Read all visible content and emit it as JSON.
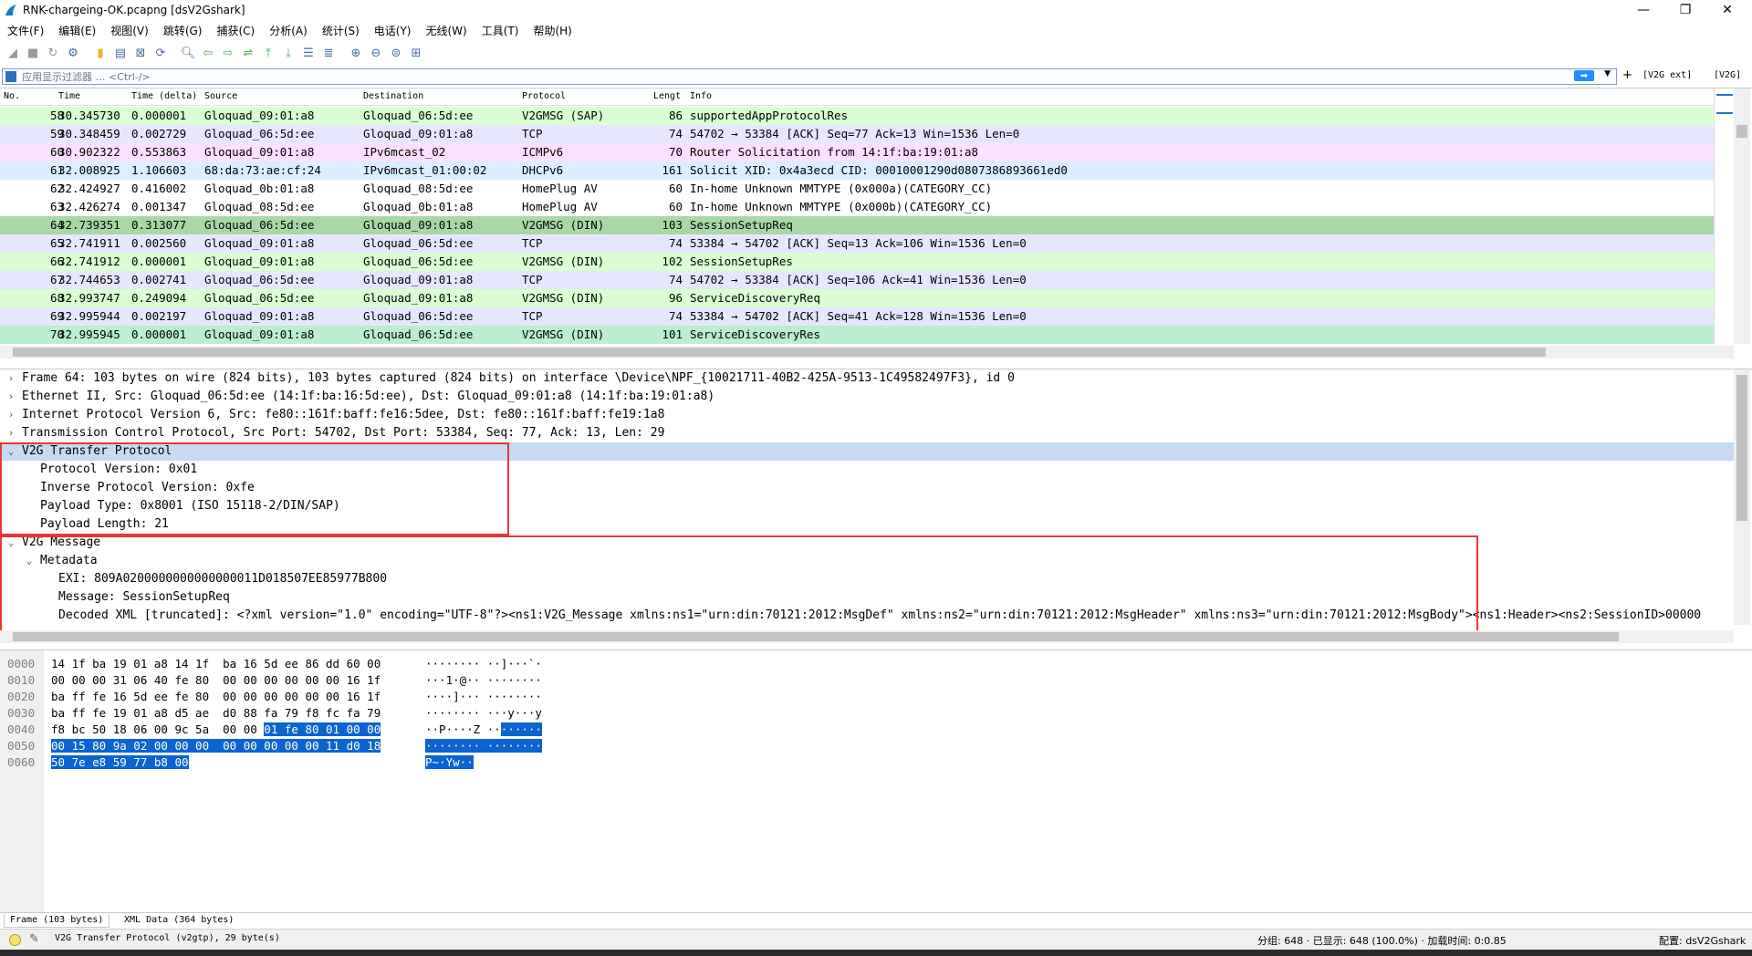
{
  "window": {
    "title": "RNK-chargeing-OK.pcapng [dsV2Gshark]",
    "minimize": "—",
    "maximize": "❐",
    "close": "✕"
  },
  "menu": [
    "文件(F)",
    "编辑(E)",
    "视图(V)",
    "跳转(G)",
    "捕获(C)",
    "分析(A)",
    "统计(S)",
    "电话(Y)",
    "无线(W)",
    "工具(T)",
    "帮助(H)"
  ],
  "filter": {
    "placeholder": "应用显示过滤器 … <Ctrl-/>",
    "apply": "➡",
    "plus": "+",
    "v2g_ext": "[V2G ext]",
    "v2g": "[V2G]"
  },
  "columns": [
    "No.",
    "Time",
    "Time (delta)",
    "Source",
    "Destination",
    "Protocol",
    "Lengt",
    "Info"
  ],
  "packets": [
    {
      "no": "58",
      "time": "30.345730",
      "delta": "0.000001",
      "src": "Gloquad_09:01:a8",
      "dst": "Gloquad_06:5d:ee",
      "proto": "V2GMSG (SAP)",
      "len": "86",
      "info": "supportedAppProtocolRes",
      "color": "#d9ffd2"
    },
    {
      "no": "59",
      "time": "30.348459",
      "delta": "0.002729",
      "src": "Gloquad_06:5d:ee",
      "dst": "Gloquad_09:01:a8",
      "proto": "TCP",
      "len": "74",
      "info": "54702 → 53384 [ACK] Seq=77 Ack=13 Win=1536 Len=0",
      "color": "#e7e6ff"
    },
    {
      "no": "60",
      "time": "30.902322",
      "delta": "0.553863",
      "src": "Gloquad_09:01:a8",
      "dst": "IPv6mcast_02",
      "proto": "ICMPv6",
      "len": "70",
      "info": "Router Solicitation from 14:1f:ba:19:01:a8",
      "color": "#fce0ff"
    },
    {
      "no": "61",
      "time": "32.008925",
      "delta": "1.106603",
      "src": "68:da:73:ae:cf:24",
      "dst": "IPv6mcast_01:00:02",
      "proto": "DHCPv6",
      "len": "161",
      "info": "Solicit XID: 0x4a3ecd CID: 00010001290d0807386893661ed0",
      "color": "#daeeff"
    },
    {
      "no": "62",
      "time": "32.424927",
      "delta": "0.416002",
      "src": "Gloquad_0b:01:a8",
      "dst": "Gloquad_08:5d:ee",
      "proto": "HomePlug AV",
      "len": "60",
      "info": "In-home Unknown MMTYPE (0x000a)(CATEGORY_CC)",
      "color": "#ffffff"
    },
    {
      "no": "63",
      "time": "32.426274",
      "delta": "0.001347",
      "src": "Gloquad_08:5d:ee",
      "dst": "Gloquad_0b:01:a8",
      "proto": "HomePlug AV",
      "len": "60",
      "info": "In-home Unknown MMTYPE (0x000b)(CATEGORY_CC)",
      "color": "#ffffff"
    },
    {
      "no": "64",
      "time": "32.739351",
      "delta": "0.313077",
      "src": "Gloquad_06:5d:ee",
      "dst": "Gloquad_09:01:a8",
      "proto": "V2GMSG (DIN)",
      "len": "103",
      "info": "SessionSetupReq",
      "color": "#a8d8a4"
    },
    {
      "no": "65",
      "time": "32.741911",
      "delta": "0.002560",
      "src": "Gloquad_09:01:a8",
      "dst": "Gloquad_06:5d:ee",
      "proto": "TCP",
      "len": "74",
      "info": "53384 → 54702 [ACK] Seq=13 Ack=106 Win=1536 Len=0",
      "color": "#e7e6ff"
    },
    {
      "no": "66",
      "time": "32.741912",
      "delta": "0.000001",
      "src": "Gloquad_09:01:a8",
      "dst": "Gloquad_06:5d:ee",
      "proto": "V2GMSG (DIN)",
      "len": "102",
      "info": "SessionSetupRes",
      "color": "#d9ffd2"
    },
    {
      "no": "67",
      "time": "32.744653",
      "delta": "0.002741",
      "src": "Gloquad_06:5d:ee",
      "dst": "Gloquad_09:01:a8",
      "proto": "TCP",
      "len": "74",
      "info": "54702 → 53384 [ACK] Seq=106 Ack=41 Win=1536 Len=0",
      "color": "#e7e6ff"
    },
    {
      "no": "68",
      "time": "32.993747",
      "delta": "0.249094",
      "src": "Gloquad_06:5d:ee",
      "dst": "Gloquad_09:01:a8",
      "proto": "V2GMSG (DIN)",
      "len": "96",
      "info": "ServiceDiscoveryReq",
      "color": "#d9ffd2"
    },
    {
      "no": "69",
      "time": "32.995944",
      "delta": "0.002197",
      "src": "Gloquad_09:01:a8",
      "dst": "Gloquad_06:5d:ee",
      "proto": "TCP",
      "len": "74",
      "info": "53384 → 54702 [ACK] Seq=41 Ack=128 Win=1536 Len=0",
      "color": "#e7e6ff"
    },
    {
      "no": "70",
      "time": "32.995945",
      "delta": "0.000001",
      "src": "Gloquad_09:01:a8",
      "dst": "Gloquad_06:5d:ee",
      "proto": "V2GMSG (DIN)",
      "len": "101",
      "info": "ServiceDiscoveryRes",
      "color": "#b9eed0"
    }
  ],
  "details": [
    {
      "arrow": "›",
      "indent": 0,
      "text": "Frame 64: 103 bytes on wire (824 bits), 103 bytes captured (824 bits) on interface \\Device\\NPF_{10021711-40B2-425A-9513-1C49582497F3}, id 0",
      "sel": false
    },
    {
      "arrow": "›",
      "indent": 0,
      "text": "Ethernet II, Src: Gloquad_06:5d:ee (14:1f:ba:16:5d:ee), Dst: Gloquad_09:01:a8 (14:1f:ba:19:01:a8)",
      "sel": false
    },
    {
      "arrow": "›",
      "indent": 0,
      "text": "Internet Protocol Version 6, Src: fe80::161f:baff:fe16:5dee, Dst: fe80::161f:baff:fe19:1a8",
      "sel": false
    },
    {
      "arrow": "›",
      "indent": 0,
      "text": "Transmission Control Protocol, Src Port: 54702, Dst Port: 53384, Seq: 77, Ack: 13, Len: 29",
      "sel": false
    },
    {
      "arrow": "⌄",
      "indent": 0,
      "text": "V2G Transfer Protocol",
      "sel": true
    },
    {
      "arrow": "",
      "indent": 1,
      "text": "Protocol Version: 0x01",
      "sel": false
    },
    {
      "arrow": "",
      "indent": 1,
      "text": "Inverse Protocol Version: 0xfe",
      "sel": false
    },
    {
      "arrow": "",
      "indent": 1,
      "text": "Payload Type: 0x8001 (ISO 15118-2/DIN/SAP)",
      "sel": false
    },
    {
      "arrow": "",
      "indent": 1,
      "text": "Payload Length: 21",
      "sel": false
    },
    {
      "arrow": "⌄",
      "indent": 0,
      "text": "V2G Message",
      "sel": false
    },
    {
      "arrow": "⌄",
      "indent": 1,
      "text": "Metadata",
      "sel": false
    },
    {
      "arrow": "",
      "indent": 2,
      "text": "EXI: 809A0200000000000000011D018507EE85977B800",
      "sel": false
    },
    {
      "arrow": "",
      "indent": 2,
      "text": "Message: SessionSetupReq",
      "sel": false
    },
    {
      "arrow": "",
      "indent": 2,
      "text": "Decoded XML [truncated]: <?xml version=\"1.0\" encoding=\"UTF-8\"?><ns1:V2G_Message xmlns:ns1=\"urn:din:70121:2012:MsgDef\" xmlns:ns2=\"urn:din:70121:2012:MsgHeader\" xmlns:ns3=\"urn:din:70121:2012:MsgBody\"><ns1:Header><ns2:SessionID>00000",
      "sel": false
    }
  ],
  "hex": [
    {
      "off": "0000",
      "b": [
        [
          "14 1f ba 19 01 a8 14 1f  ba 16 5d ee 86 dd 60 00",
          ""
        ]
      ],
      "a": [
        [
          "········ ··]···`·",
          ""
        ]
      ]
    },
    {
      "off": "0010",
      "b": [
        [
          "00 00 00 31 06 40 fe 80  00 00 00 00 00 00 16 1f",
          ""
        ]
      ],
      "a": [
        [
          "···1·@·· ········",
          ""
        ]
      ]
    },
    {
      "off": "0020",
      "b": [
        [
          "ba ff fe 16 5d ee fe 80  00 00 00 00 00 00 16 1f",
          ""
        ]
      ],
      "a": [
        [
          "····]··· ········",
          ""
        ]
      ]
    },
    {
      "off": "0030",
      "b": [
        [
          "ba ff fe 19 01 a8 d5 ae  d0 88 fa 79 f8 fc fa 79",
          ""
        ]
      ],
      "a": [
        [
          "········ ···y···y",
          ""
        ]
      ]
    },
    {
      "off": "0040",
      "b": [
        [
          "f8 bc 50 18 06 00 9c 5a  00 00 ",
          ""
        ],
        [
          "01 fe 80 01 00 00",
          "hl"
        ]
      ],
      "a": [
        [
          "··P····Z ··",
          ""
        ],
        [
          "······",
          "hl"
        ]
      ]
    },
    {
      "off": "0050",
      "b": [
        [
          "00 15 80 9a 02 00 00 00  00 00 00 00 00 11 d0 18",
          "hl"
        ]
      ],
      "a": [
        [
          "········ ········",
          "hl"
        ]
      ]
    },
    {
      "off": "0060",
      "b": [
        [
          "50 7e e8 59 77 b8 00",
          "hl"
        ]
      ],
      "a": [
        [
          "P~·Yw··",
          "hl"
        ]
      ]
    }
  ],
  "byte_tabs": [
    "Frame (103 bytes)",
    "XML Data (364 bytes)"
  ],
  "status": {
    "text": "V2G Transfer Protocol (v2gtp), 29 byte(s)",
    "stats": "分组: 648 · 已显示: 648 (100.0%) · 加载时间: 0:0.85",
    "profile": "配置: dsV2Gshark"
  }
}
